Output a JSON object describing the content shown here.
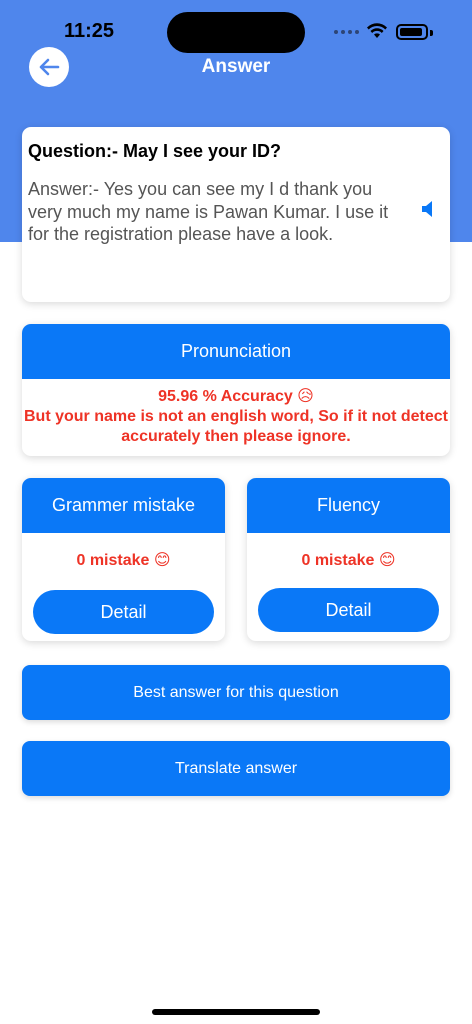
{
  "status_bar": {
    "time": "11:25"
  },
  "header": {
    "title": "Answer",
    "back_icon": "arrow-left-icon"
  },
  "qa": {
    "question": "Question:- May I see your ID?",
    "answer": "Answer:- Yes you can see my I d thank you very much my name is Pawan Kumar. I use it for the registration please have a look.",
    "speaker_icon": "speaker-icon"
  },
  "pronunciation": {
    "title": "Pronunciation",
    "accuracy": "95.96 % Accuracy 😥",
    "note": "But your name is not an english word, So if it not detect accurately then please ignore."
  },
  "grammar": {
    "title": "Grammer mistake",
    "result": "0 mistake 😊",
    "button": "Detail"
  },
  "fluency": {
    "title": "Fluency",
    "result": "0 mistake 😊",
    "button": "Detail"
  },
  "actions": {
    "best_answer": "Best answer for this question",
    "translate": "Translate answer"
  },
  "colors": {
    "header": "#4f86ec",
    "primary": "#0a78f7",
    "error": "#ee3326"
  }
}
